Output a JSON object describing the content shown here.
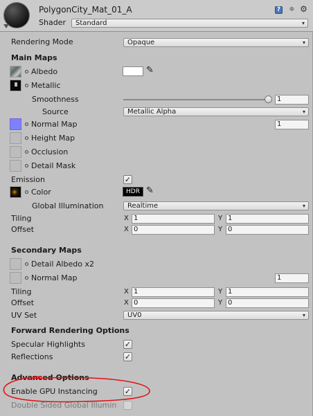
{
  "header": {
    "material_name": "PolygonCity_Mat_01_A",
    "shader_label": "Shader",
    "shader_value": "Standard",
    "help_icon": "help-icon",
    "settings_icon": "settings-icon",
    "gear_icon": "gear-icon"
  },
  "rendering_mode": {
    "label": "Rendering Mode",
    "value": "Opaque"
  },
  "main_maps": {
    "heading": "Main Maps",
    "albedo": "Albedo",
    "metallic": "Metallic",
    "smoothness": {
      "label": "Smoothness",
      "value": "1",
      "slider_fraction": 1.0
    },
    "source": {
      "label": "Source",
      "value": "Metallic Alpha"
    },
    "normal_map": {
      "label": "Normal Map",
      "value": "1"
    },
    "height_map": "Height Map",
    "occlusion": "Occlusion",
    "detail_mask": "Detail Mask",
    "emission": {
      "label": "Emission",
      "checked": true
    },
    "color": {
      "label": "Color",
      "hdr": "HDR"
    },
    "global_illumination": {
      "label": "Global Illumination",
      "value": "Realtime"
    },
    "tiling": {
      "label": "Tiling",
      "x": "1",
      "y": "1"
    },
    "offset": {
      "label": "Offset",
      "x": "0",
      "y": "0"
    }
  },
  "secondary_maps": {
    "heading": "Secondary Maps",
    "detail_albedo": "Detail Albedo x2",
    "normal_map": {
      "label": "Normal Map",
      "value": "1"
    },
    "tiling": {
      "label": "Tiling",
      "x": "1",
      "y": "1"
    },
    "offset": {
      "label": "Offset",
      "x": "0",
      "y": "0"
    },
    "uv_set": {
      "label": "UV Set",
      "value": "UV0"
    }
  },
  "forward_rendering": {
    "heading": "Forward Rendering Options",
    "specular_highlights": {
      "label": "Specular Highlights",
      "checked": true
    },
    "reflections": {
      "label": "Reflections",
      "checked": true
    }
  },
  "advanced": {
    "heading": "Advanced Options",
    "gpu_instancing": {
      "label": "Enable GPU Instancing",
      "checked": true
    },
    "double_sided_gi": {
      "label": "Double Sided Global Illumin",
      "checked": false
    }
  },
  "axis_labels": {
    "x": "X",
    "y": "Y"
  },
  "colors": {
    "panel_bg": "#c2c2c2",
    "normal_swatch": "#8080ff",
    "annotation_red": "#e01010"
  }
}
